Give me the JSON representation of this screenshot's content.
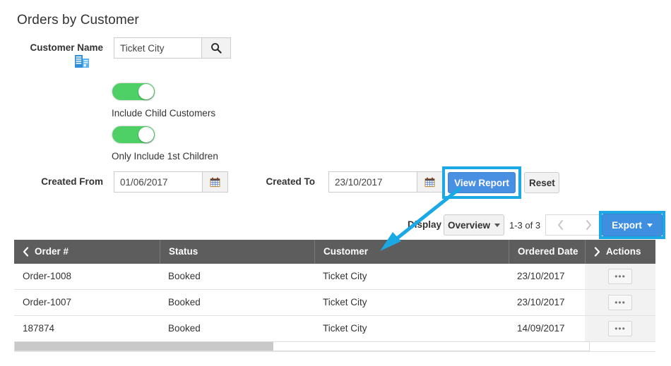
{
  "page": {
    "title": "Orders by Customer"
  },
  "filters": {
    "customer_name": {
      "label": "Customer Name",
      "icon": "building-icon",
      "value": "Ticket City",
      "placeholder": "Customer Name",
      "search_icon": "search-icon"
    },
    "toggles": [
      {
        "caption": "Include Child Customers",
        "state": "on"
      },
      {
        "caption": "Only Include 1st Children",
        "state": "on"
      }
    ],
    "created_from": {
      "label": "Created From",
      "value": "01/06/2017",
      "icon": "calendar-icon"
    },
    "created_to": {
      "label": "Created To",
      "value": "23/10/2017",
      "icon": "calendar-icon"
    },
    "view_report_label": "View Report",
    "reset_label": "Reset"
  },
  "toolbar": {
    "display_label": "Display",
    "display_value": "Overview",
    "range_text": "1-3 of 3",
    "prev_icon": "chevron-left-icon",
    "next_icon": "chevron-right-icon",
    "export_label": "Export"
  },
  "table": {
    "columns": [
      {
        "label": "Order #",
        "chevron": "chevron-left-icon"
      },
      {
        "label": "Status",
        "chevron": ""
      },
      {
        "label": "Customer",
        "chevron": ""
      },
      {
        "label": "Ordered Date",
        "chevron": ""
      },
      {
        "label": "Actions",
        "chevron": "chevron-right-icon"
      }
    ],
    "rows": [
      {
        "order": "Order-1008",
        "status": "Booked",
        "customer": "Ticket City",
        "ordered_date": "23/10/2017",
        "action_label": "•••"
      },
      {
        "order": "Order-1007",
        "status": "Booked",
        "customer": "Ticket City",
        "ordered_date": "23/10/2017",
        "action_label": "•••"
      },
      {
        "order": "187874",
        "status": "Booked",
        "customer": "Ticket City",
        "ordered_date": "14/09/2017",
        "action_label": "•••"
      }
    ]
  },
  "annotations": {
    "highlight_color": "#1ba9e6",
    "highlighted_elements": [
      "View Report",
      "Export"
    ],
    "arrow": "arrow-pointing-to-results-grid"
  },
  "colors": {
    "primary_button": "#4a90e2",
    "toggle_on": "#4ed066",
    "table_header": "#5d5d5d",
    "highlight": "#1ba9e6"
  }
}
